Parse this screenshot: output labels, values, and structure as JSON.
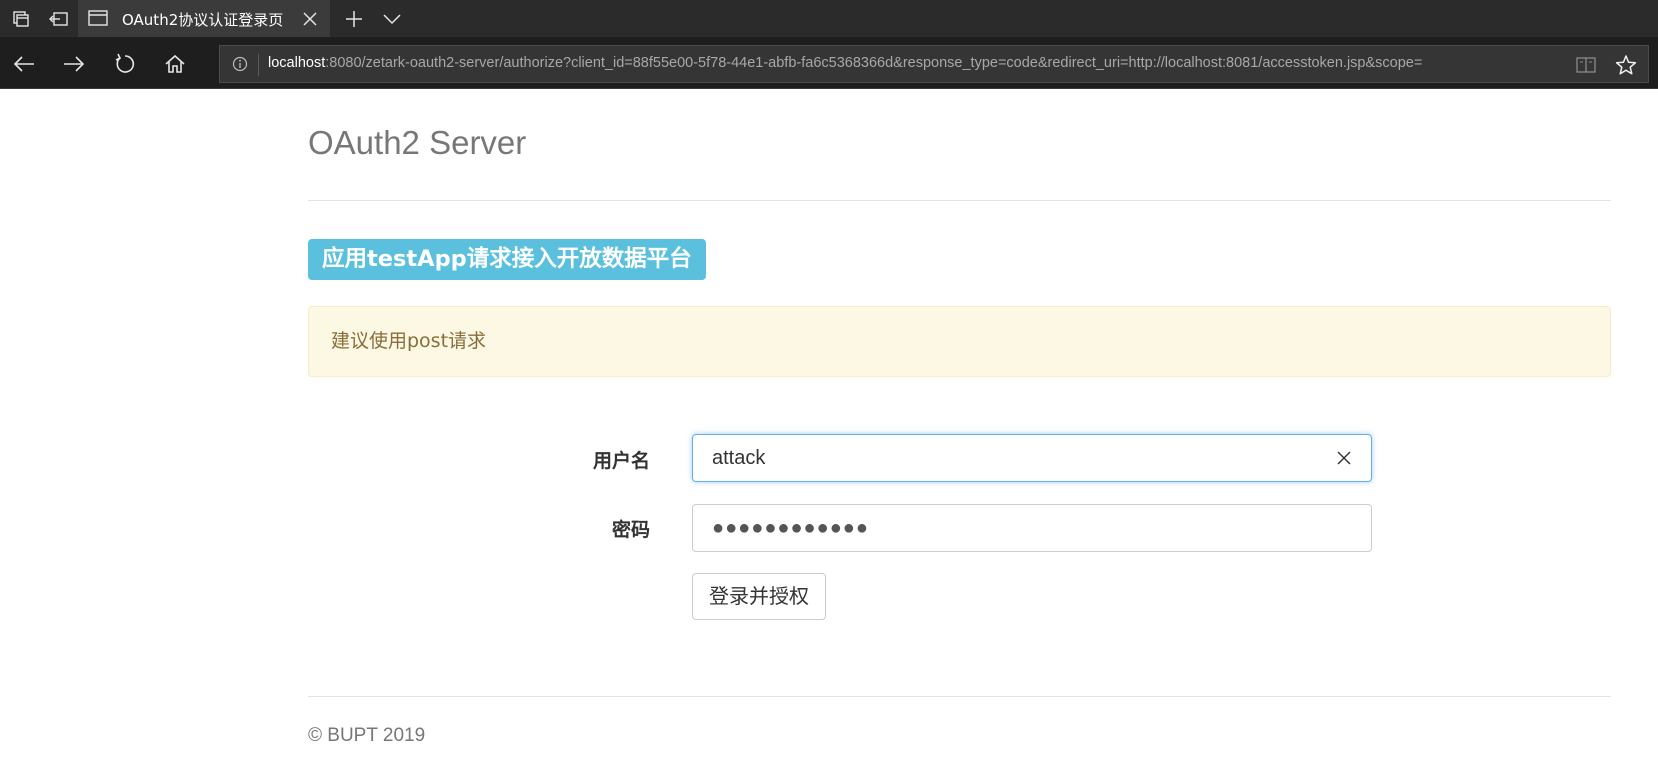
{
  "tabstrip": {
    "tab_title": "OAuth2协议认证登录页"
  },
  "navbar": {
    "url_host": "localhost",
    "url_rest": ":8080/zetark-oauth2-server/authorize?client_id=88f55e00-5f78-44e1-abfb-fa6c5368366d&response_type=code&redirect_uri=http://localhost:8081/accesstoken.jsp&scope="
  },
  "page": {
    "title": "OAuth2 Server",
    "app_badge": "应用testApp请求接入开放数据平台",
    "alert": "建议使用post请求",
    "username_label": "用户名",
    "username_value": "attack",
    "password_label": "密码",
    "password_value": "●●●●●●●●●●●●",
    "submit_label": "登录并授权",
    "footer": "© BUPT 2019"
  },
  "colors": {
    "badge_bg": "#5bc0de",
    "alert_bg": "#fcf8e3",
    "alert_text": "#8a6d3b",
    "focus_border": "#66afe9"
  },
  "icons": [
    "tab-set-aside-icon",
    "tab-restore-icon",
    "page-icon",
    "close-icon",
    "new-tab-icon",
    "chevron-down-icon",
    "back-arrow-icon",
    "forward-arrow-icon",
    "refresh-icon",
    "home-icon",
    "info-icon",
    "reading-view-icon",
    "favorite-star-icon",
    "clear-x-icon"
  ]
}
